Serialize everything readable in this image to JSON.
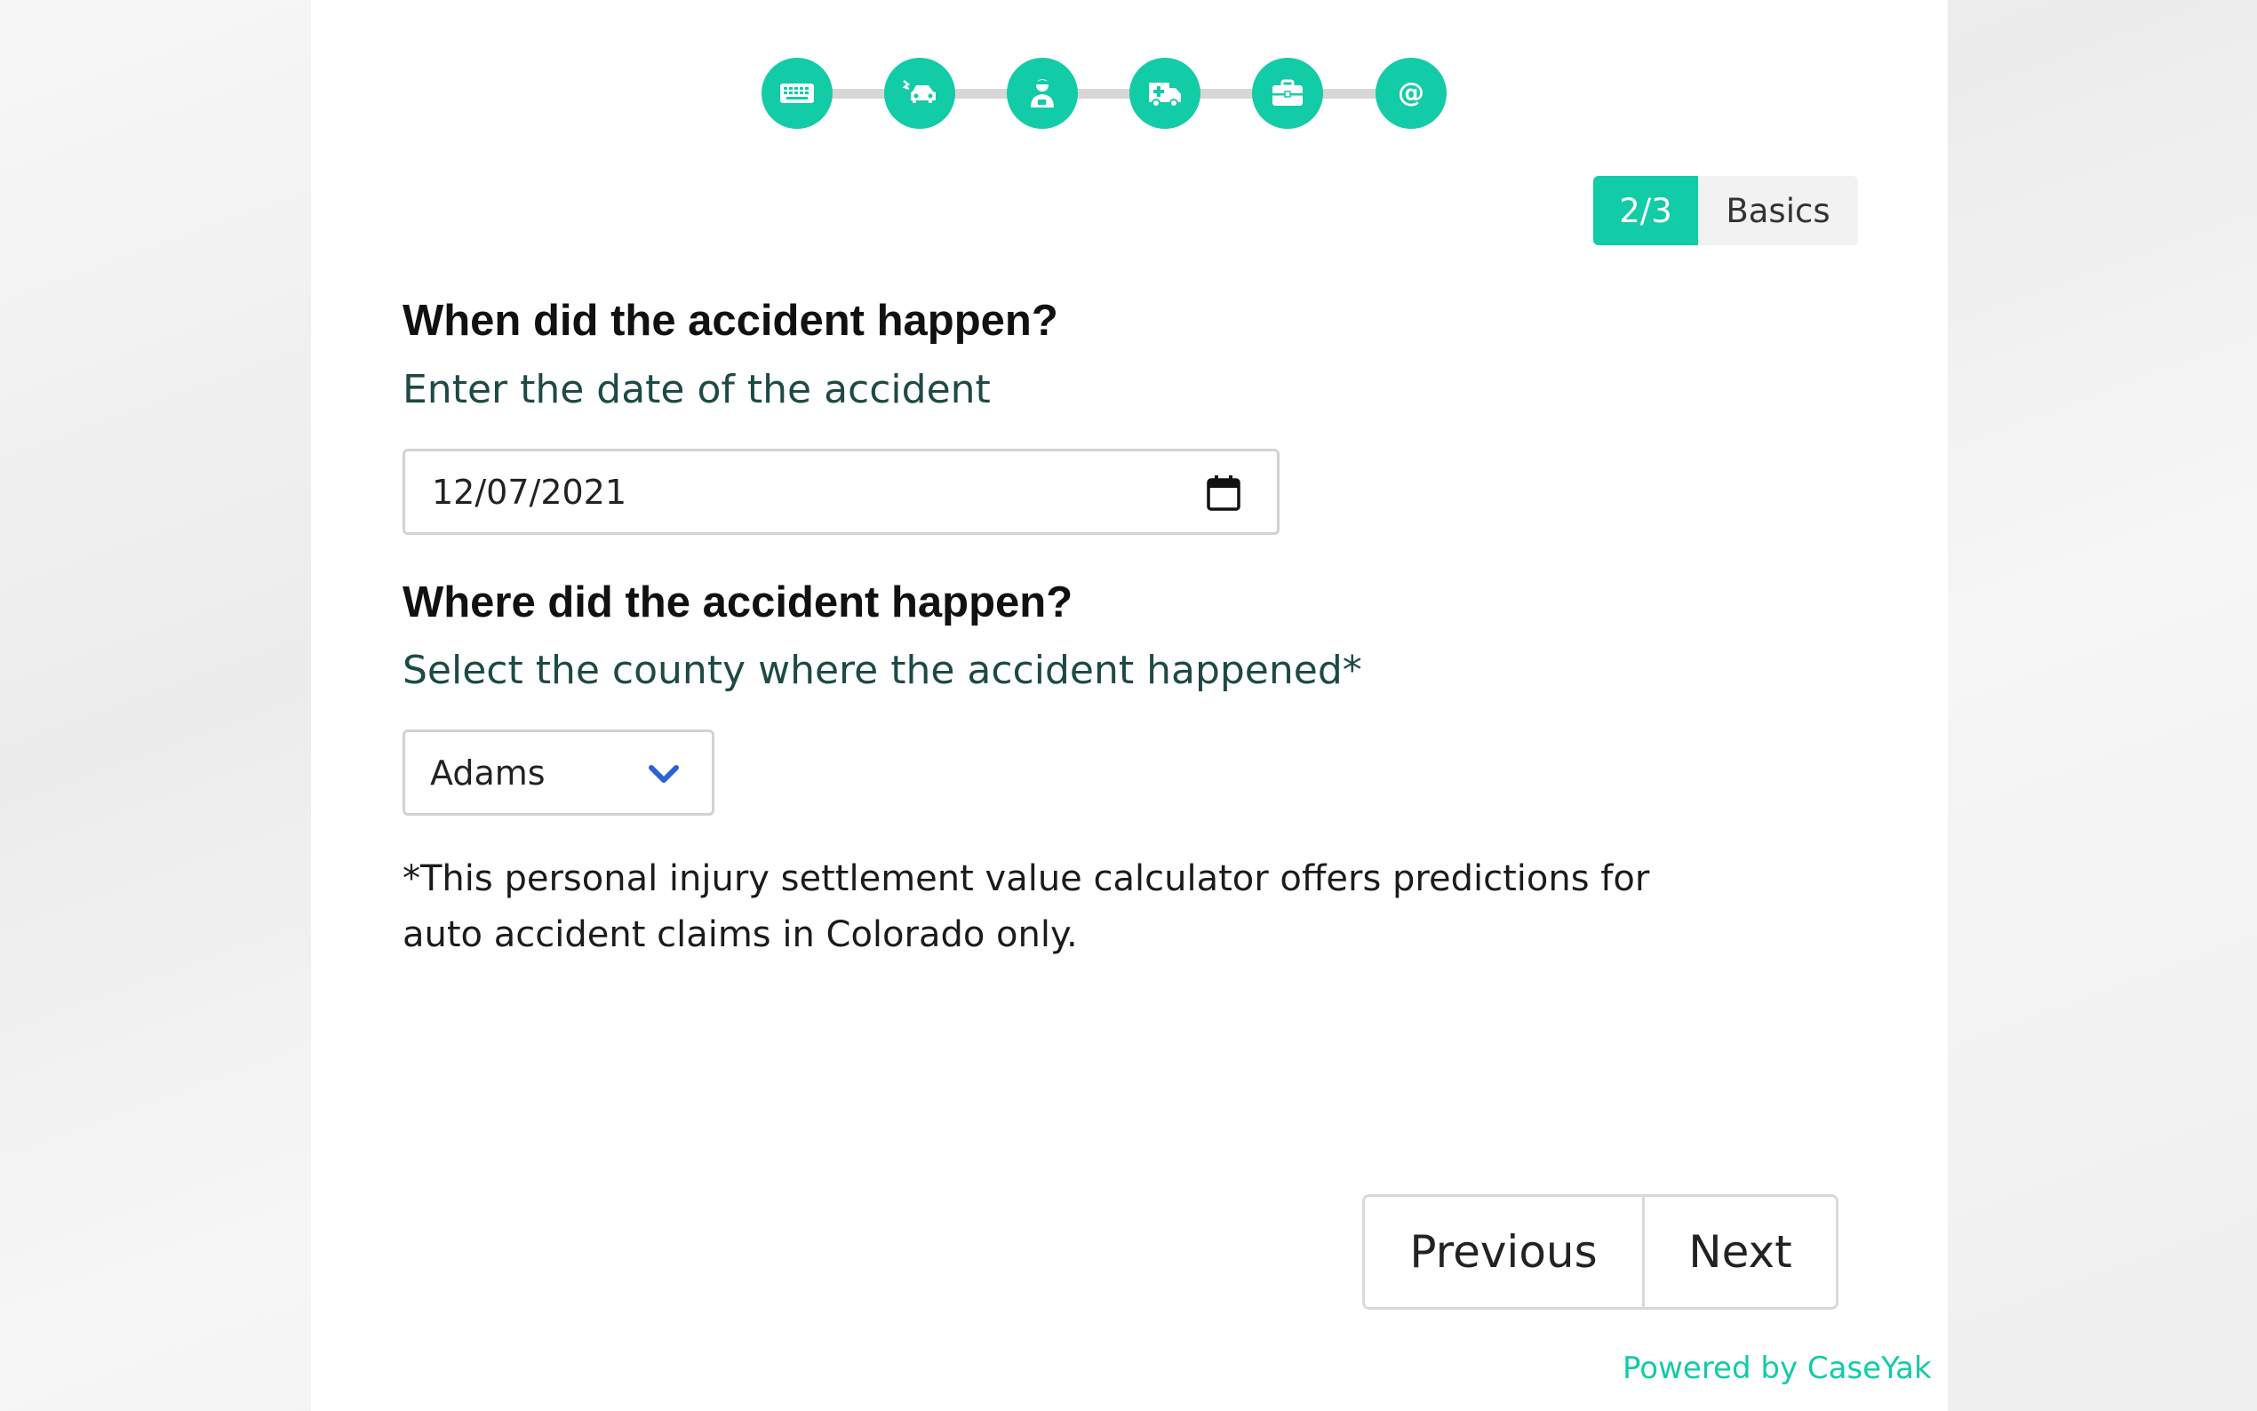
{
  "stepper": {
    "steps": [
      {
        "icon": "keyboard-icon"
      },
      {
        "icon": "car-crash-icon"
      },
      {
        "icon": "user-injured-icon"
      },
      {
        "icon": "ambulance-icon"
      },
      {
        "icon": "briefcase-icon"
      },
      {
        "icon": "at-sign-icon"
      }
    ]
  },
  "progress": {
    "count": "2/3",
    "section": "Basics"
  },
  "questions": {
    "date": {
      "title": "When did the accident happen?",
      "subtitle": "Enter the date of the accident",
      "value": "12/07/2021"
    },
    "location": {
      "title": "Where did the accident happen?",
      "subtitle": "Select the county where the accident happened*",
      "selected": "Adams"
    }
  },
  "disclaimer": "*This personal injury settlement value calculator offers predictions for auto accident claims in Colorado only.",
  "nav": {
    "previous": "Previous",
    "next": "Next"
  },
  "footer": {
    "powered_by": "Powered by CaseYak"
  },
  "colors": {
    "accent": "#12cba7",
    "subtitle": "#1d4a44",
    "select_chevron": "#2a62d8"
  }
}
